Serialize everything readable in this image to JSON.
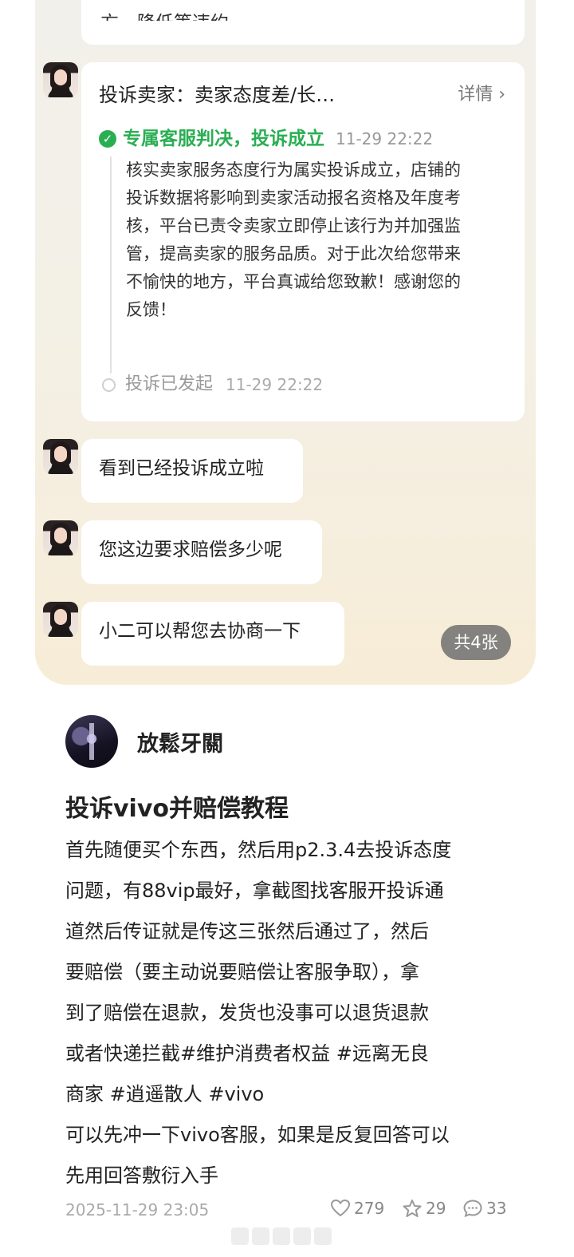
{
  "screenshot": {
    "top_stub_text": "方，降低等违约。",
    "complaint_card": {
      "title": "投诉卖家：卖家态度差/长…",
      "detail_link": "详情 ›",
      "status": {
        "label": "专属客服判决，投诉成立",
        "time": "11-29 22:22",
        "body": "核实卖家服务态度行为属实投诉成立，店铺的投诉数据将影响到卖家活动报名资格及年度考核，平台已责令卖家立即停止该行为并加强监管，提高卖家的服务品质。对于此次给您带来不愉快的地方，平台真诚给您致歉！感谢您的反馈！"
      },
      "sent": {
        "label": "投诉已发起",
        "time": "11-29 22:22"
      }
    },
    "messages": [
      "看到已经投诉成立啦",
      "您这边要求赔偿多少呢",
      "小二可以帮您去协商一下"
    ],
    "image_count": "共4张"
  },
  "post": {
    "author": "放鬆牙關",
    "title": "投诉vivo并赔偿教程",
    "body_lines": [
      "首先随便买个东西，然后用p2.3.4去投诉态度",
      "问题，有88vip最好，拿截图找客服开投诉通",
      "道然后传证就是传这三张然后通过了，然后",
      "要赔偿（要主动说要赔偿让客服争取），拿",
      "到了赔偿在退款，发货也没事可以退货退款",
      "或者快递拦截#维护消费者权益 #远离无良",
      "商家 #逍遥散人 #vivo",
      "可以先冲一下vivo客服，如果是反复回答可以",
      "先用回答敷衍入手"
    ],
    "date": "2025-11-29 23:05",
    "likes": "279",
    "favorites": "29",
    "comments": "33"
  },
  "colors": {
    "success_green": "#2aae52",
    "badge_gray": "#6e6e6e"
  },
  "icons": [
    "check-circle-icon",
    "hollow-circle-icon",
    "heart-icon",
    "star-icon",
    "comment-icon"
  ]
}
